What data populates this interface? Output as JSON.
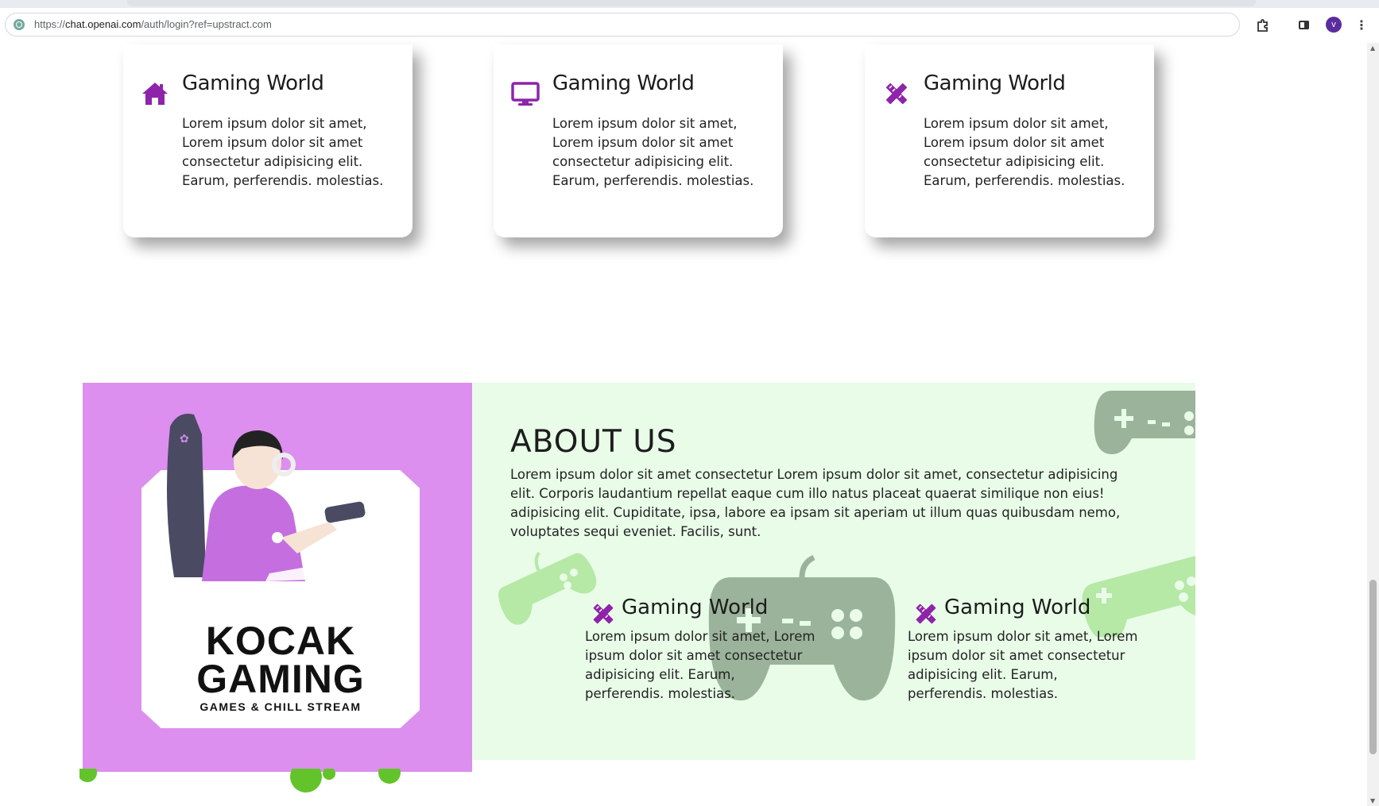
{
  "browser": {
    "url_prefix": "https://",
    "url_host": "chat.openai.com",
    "url_path": "/auth/login?ref=upstract.com",
    "avatar_letter": "v",
    "icons": [
      "site-icon",
      "extensions-icon",
      "side-panel-icon",
      "menu-dots-icon"
    ]
  },
  "cards": [
    {
      "icon": "home-icon",
      "title": "Gaming World",
      "text": "Lorem ipsum dolor sit amet, Lorem ipsum dolor sit amet consectetur adipisicing elit. Earum, perferendis. molestias."
    },
    {
      "icon": "monitor-icon",
      "title": "Gaming World",
      "text": "Lorem ipsum dolor sit amet, Lorem ipsum dolor sit amet consectetur adipisicing elit. Earum, perferendis. molestias."
    },
    {
      "icon": "pencil-ruler-icon",
      "title": "Gaming World",
      "text": "Lorem ipsum dolor sit amet, Lorem ipsum dolor sit amet consectetur adipisicing elit. Earum, perferendis. molestias."
    }
  ],
  "about": {
    "title": "ABOUT US",
    "text": "Lorem ipsum dolor sit amet consectetur Lorem ipsum dolor sit amet, consectetur adipisicing elit. Corporis laudantium repellat eaque cum illo natus placeat quaerat similique non eius! adipisicing elit. Cupiditate, ipsa, labore ea ipsam sit aperiam ut illum quas quibusdam nemo, voluptates sequi eveniet. Facilis, sunt.",
    "logo_line1": "KOCAK",
    "logo_line2": "GAMING",
    "logo_sub": "GAMES & CHILL STREAM",
    "features": [
      {
        "icon": "pencil-ruler-icon",
        "title": "Gaming World",
        "text": "Lorem ipsum dolor sit amet, Lorem ipsum dolor sit amet consectetur adipisicing elit. Earum, perferendis. molestias."
      },
      {
        "icon": "pencil-ruler-icon",
        "title": "Gaming World",
        "text": "Lorem ipsum dolor sit amet, Lorem ipsum dolor sit amet consectetur adipisicing elit. Earum, perferendis. molestias."
      }
    ]
  },
  "colors": {
    "accent_purple": "#8e24aa",
    "about_left_bg": "#dc8fee",
    "about_right_bg": "#e8fce8",
    "controller_dark": "#9bb39b",
    "controller_light": "#b6e8a6"
  }
}
